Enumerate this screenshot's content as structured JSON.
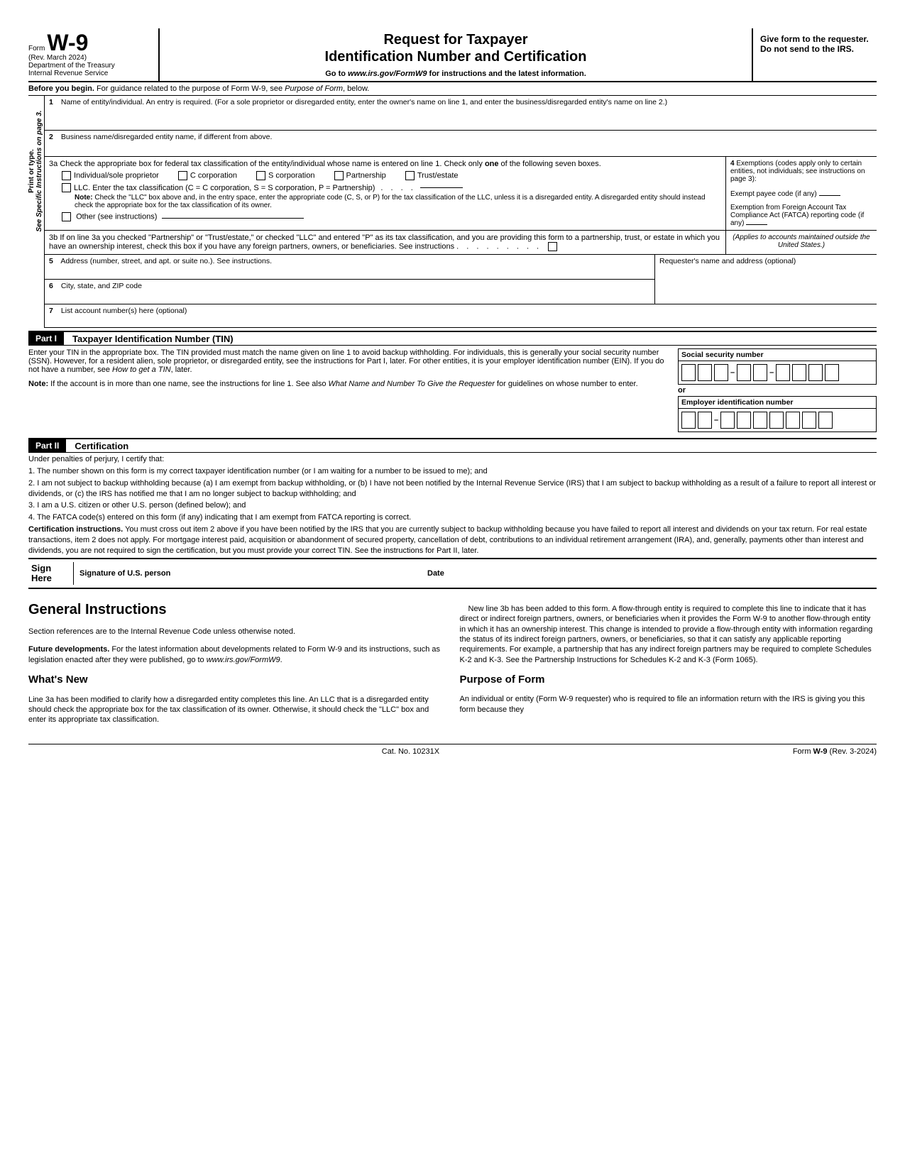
{
  "header": {
    "form_prefix": "Form",
    "form_number": "W-9",
    "revision": "(Rev. March 2024)",
    "dept": "Department of the Treasury",
    "irs": "Internal Revenue Service",
    "title1": "Request for Taxpayer",
    "title2": "Identification Number and Certification",
    "goto_prefix": "Go to ",
    "goto_link": "www.irs.gov/FormW9",
    "goto_suffix": " for instructions and the latest information.",
    "give": "Give form to the requester. Do not send to the IRS."
  },
  "before": {
    "bold": "Before you begin.",
    "text": " For guidance related to the purpose of Form W-9, see ",
    "italic": "Purpose of Form",
    "end": ", below."
  },
  "side": {
    "line1": "Print or type.",
    "line2": "See Specific Instructions on page 3."
  },
  "l1": {
    "num": "1",
    "text": "Name of entity/individual. An entry is required. (For a sole proprietor or disregarded entity, enter the owner's name on line 1, and enter the business/disregarded entity's name on line 2.)"
  },
  "l2": {
    "num": "2",
    "text": "Business name/disregarded entity name, if different from above."
  },
  "l3a": {
    "num": "3a",
    "text": "Check the appropriate box for federal tax classification of the entity/individual whose name is entered on line 1. Check only ",
    "bold": "one",
    "text2": " of the following seven boxes.",
    "cb1": "Individual/sole proprietor",
    "cb2": "C corporation",
    "cb3": "S corporation",
    "cb4": "Partnership",
    "cb5": "Trust/estate",
    "llc": "LLC. Enter the tax classification (C = C corporation, S = S corporation, P = Partnership)",
    "note_bold": "Note:",
    "note": " Check the \"LLC\" box above and, in the entry space, enter the appropriate code (C, S, or P) for the tax classification of the LLC, unless it is a disregarded entity. A disregarded entity should instead check the appropriate box for the tax classification of its owner.",
    "other": "Other (see instructions)"
  },
  "l4": {
    "num": "4",
    "text": "Exemptions (codes apply only to certain entities, not individuals; see instructions on page 3):",
    "payee": "Exempt payee code (if any)",
    "fatca": "Exemption from Foreign Account Tax Compliance Act (FATCA) reporting code (if any)",
    "applies": "(Applies to accounts maintained outside the United States.)"
  },
  "l3b": {
    "num": "3b",
    "text": "If on line 3a you checked \"Partnership\" or \"Trust/estate,\" or checked \"LLC\" and entered \"P\" as its tax classification, and you are providing this form to a partnership, trust, or estate in which you have an ownership interest, check this box if you have any foreign partners, owners, or beneficiaries. See instructions"
  },
  "l5": {
    "num": "5",
    "text": "Address (number, street, and apt. or suite no.). See instructions."
  },
  "l6": {
    "num": "6",
    "text": "City, state, and ZIP code"
  },
  "l7": {
    "num": "7",
    "text": "List account number(s) here (optional)"
  },
  "requester": "Requester's name and address (optional)",
  "part1": {
    "tag": "Part I",
    "title": "Taxpayer Identification Number (TIN)",
    "p1a": "Enter your TIN in the appropriate box. The TIN provided must match the name given on line 1 to avoid backup withholding. For individuals, this is generally your social security number (SSN). However, for a resident alien, sole proprietor, or disregarded entity, see the instructions for Part I, later. For other entities, it is your employer identification number (EIN). If you do not have a number, see ",
    "p1i": "How to get a TIN",
    "p1b": ", later.",
    "note_bold": "Note:",
    "p2a": " If the account is in more than one name, see the instructions for line 1. See also ",
    "p2i": "What Name and Number To Give the Requester",
    "p2b": " for guidelines on whose number to enter.",
    "ssn": "Social security number",
    "or": "or",
    "ein": "Employer identification number"
  },
  "part2": {
    "tag": "Part II",
    "title": "Certification",
    "intro": "Under penalties of perjury, I certify that:",
    "i1": "1. The number shown on this form is my correct taxpayer identification number (or I am waiting for a number to be issued to me); and",
    "i2": "2. I am not subject to backup withholding because (a) I am exempt from backup withholding, or (b) I have not been notified by the Internal Revenue Service (IRS) that I am subject to backup withholding as a result of a failure to report all interest or dividends, or (c) the IRS has notified me that I am no longer subject to backup withholding; and",
    "i3": "3. I am a U.S. citizen or other U.S. person (defined below); and",
    "i4": "4. The FATCA code(s) entered on this form (if any) indicating that I am exempt from FATCA reporting is correct.",
    "ci_bold": "Certification instructions.",
    "ci": " You must cross out item 2 above if you have been notified by the IRS that you are currently subject to backup withholding because you have failed to report all interest and dividends on your tax return. For real estate transactions, item 2 does not apply. For mortgage interest paid, acquisition or abandonment of secured property, cancellation of debt, contributions to an individual retirement arrangement (IRA), and, generally, payments other than interest and dividends, you are not required to sign the certification, but you must provide your correct TIN. See the instructions for Part II, later."
  },
  "sign": {
    "here": "Sign Here",
    "sig": "Signature of U.S. person",
    "date": "Date"
  },
  "instr": {
    "gi": "General Instructions",
    "p1": "Section references are to the Internal Revenue Code unless otherwise noted.",
    "fd_bold": "Future developments.",
    "fd": " For the latest information about developments related to Form W-9 and its instructions, such as legislation enacted after they were published, go to ",
    "fd_link": "www.irs.gov/FormW9",
    "fd_end": ".",
    "wn": "What's New",
    "wn1": "Line 3a has been modified to clarify how a disregarded entity completes this line. An LLC that is a disregarded entity should check the appropriate box for the tax classification of its owner. Otherwise, it should check the \"LLC\" box and enter its appropriate tax classification.",
    "col2a": "New line 3b has been added to this form. A flow-through entity is required to complete this line to indicate that it has direct or indirect foreign partners, owners, or beneficiaries when it provides the Form W-9 to another flow-through entity in which it has an ownership interest. This change is intended to provide a flow-through entity with information regarding the status of its indirect foreign partners, owners, or beneficiaries, so that it can satisfy any applicable reporting requirements. For example, a partnership that has any indirect foreign partners may be required to complete Schedules K-2 and K-3. See the Partnership Instructions for Schedules K-2 and K-3 (Form 1065).",
    "pof": "Purpose of Form",
    "pof1": "An individual or entity (Form W-9 requester) who is required to file an information return with the IRS is giving you this form because they"
  },
  "footer": {
    "cat": "Cat. No. 10231X",
    "rev_pre": "Form ",
    "rev_bold": "W-9",
    "rev_post": " (Rev. 3-2024)"
  }
}
